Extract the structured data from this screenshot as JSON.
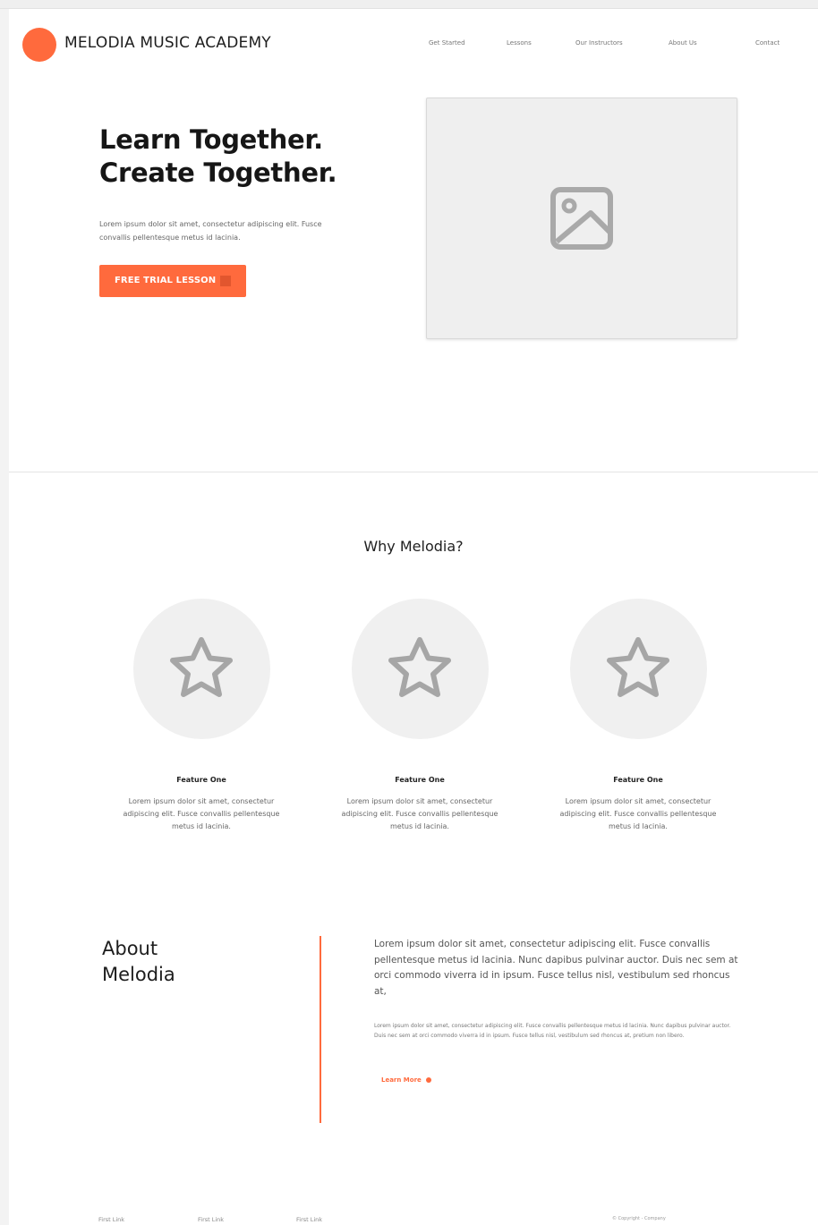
{
  "brand": {
    "name": "MELODIA MUSIC ACADEMY",
    "logo_color": "#ff6a3d"
  },
  "nav": {
    "items": [
      "Get Started",
      "Lessons",
      "Our Instructors",
      "About Us",
      "Contact"
    ]
  },
  "hero": {
    "title_line1": "Learn Together.",
    "title_line2": "Create Together.",
    "text": "Lorem ipsum dolor sit amet, consectetur adipiscing elit. Fusce convallis pellentesque metus id lacinia.",
    "cta_label": "FREE TRIAL LESSON",
    "image_icon": "image-placeholder-icon"
  },
  "features": {
    "title": "Why Melodia?",
    "items": [
      {
        "title": "Feature One",
        "text": "Lorem ipsum dolor sit amet, consectetur adipiscing elit. Fusce convallis pellentesque metus id lacinia.",
        "icon": "star-icon"
      },
      {
        "title": "Feature One",
        "text": "Lorem ipsum dolor sit amet, consectetur adipiscing elit. Fusce convallis pellentesque metus id lacinia.",
        "icon": "star-icon"
      },
      {
        "title": "Feature One",
        "text": "Lorem ipsum dolor sit amet, consectetur adipiscing elit. Fusce convallis pellentesque metus id lacinia.",
        "icon": "star-icon"
      }
    ]
  },
  "about": {
    "title_line1": "About",
    "title_line2": "Melodia",
    "lead": "Lorem ipsum dolor sit amet, consectetur adipiscing elit. Fusce convallis pellentesque metus id lacinia. Nunc dapibus pulvinar auctor. Duis nec sem at orci commodo viverra id in ipsum. Fusce tellus nisl, vestibulum sed rhoncus at,",
    "body": "Lorem ipsum dolor sit amet, consectetur adipiscing elit. Fusce convallis pellentesque metus id lacinia. Nunc dapibus pulvinar auctor. Duis nec sem at orci commodo viverra id in ipsum. Fusce tellus nisl, vestibulum sed rhoncus at, pretium non libero.",
    "link_label": "Learn More"
  },
  "footer": {
    "links": [
      "First Link",
      "First Link",
      "First Link"
    ],
    "copyright": "© Copyright - Company"
  },
  "colors": {
    "accent": "#ff6a3d",
    "placeholder": "#efefef"
  }
}
